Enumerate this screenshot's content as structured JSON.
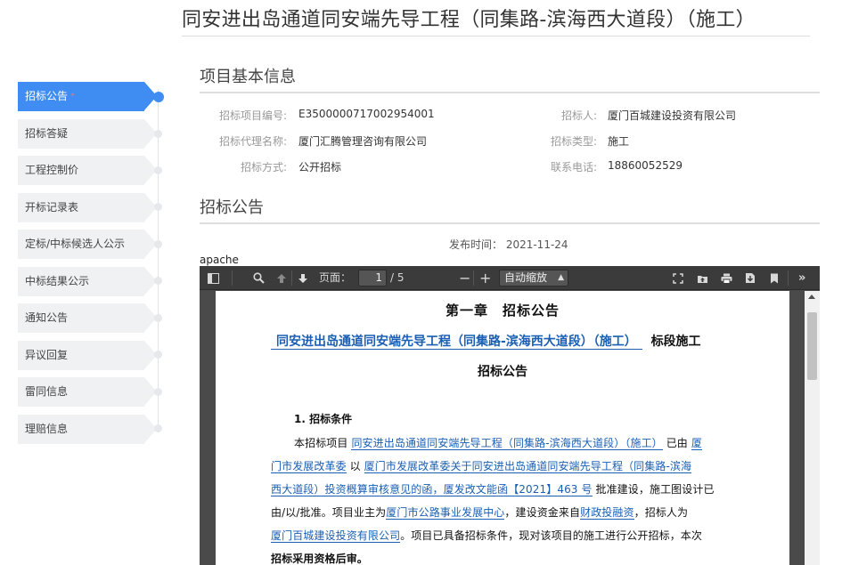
{
  "page": {
    "title": "同安进出岛通道同安端先导工程（同集路-滨海西大道段）（施工）"
  },
  "nav": {
    "items": [
      {
        "label": "招标公告",
        "active": true,
        "required": "*"
      },
      {
        "label": "招标答疑"
      },
      {
        "label": "工程控制价"
      },
      {
        "label": "开标记录表"
      },
      {
        "label": "定标/中标候选人公示"
      },
      {
        "label": "中标结果公示"
      },
      {
        "label": "通知公告"
      },
      {
        "label": "异议回复"
      },
      {
        "label": "雷同信息"
      },
      {
        "label": "理赔信息"
      }
    ]
  },
  "basic_info": {
    "section_title": "项目基本信息",
    "fields": [
      {
        "label": "招标项目编号:",
        "value": "E3500000717002954001"
      },
      {
        "label": "招标人:",
        "value": "厦门百城建设投资有限公司"
      },
      {
        "label": "招标代理名称:",
        "value": "厦门汇腾管理咨询有限公司"
      },
      {
        "label": "招标类型:",
        "value": "施工"
      },
      {
        "label": "招标方式:",
        "value": "公开招标"
      },
      {
        "label": "联系电话:",
        "value": "18860052529"
      }
    ]
  },
  "announcement": {
    "section_title": "招标公告",
    "publish_time": "发布时间： 2021-11-24"
  },
  "viewer": {
    "frame_label": "apache",
    "page_label": "页面：",
    "current_page": "1",
    "total_pages": "/ 5",
    "zoom": "自动缩放"
  },
  "document": {
    "chapter": "第一章　招标公告",
    "project_name": "同安进出岛通道同安端先导工程（同集路-滨海西大道段）（施工）",
    "project_suffix": "标段施工",
    "heading": "招标公告",
    "section1": "1. 招标条件",
    "l1_a": "本招标项目",
    "l1_b": "同安进出岛通道同安端先导工程（同集路-滨海西大道段）（施工）",
    "l1_c": "已由",
    "l1_d": "厦",
    "l2_a": "门市发展改革委",
    "l2_b": "以",
    "l2_c": "厦门市发展改革委关于同安进出岛通道同安端先导工程（同集路-滨海",
    "l3_a": "西大道段）投资概算审核意见的函，厦发改文能函【2021】463 号",
    "l3_b": "批准建设，施工图设计已",
    "l4_a": "由/以/批准。项目业主为",
    "l4_b": "厦门市公路事业发展中心",
    "l4_c": "，建设资金来自",
    "l4_d": "财政投融资",
    "l4_e": "，招标人为",
    "l5_a": "厦门百城建设投资有限公司",
    "l5_b": "。项目已具备招标条件，现对该项目的施工进行公开招标，本次",
    "l6": "招标采用资格后审。"
  },
  "colors": {
    "accent": "#3f8cf2",
    "nav_bg": "#f0f1f3",
    "link": "#1a5fb4",
    "toolbar": "#3b3b3b"
  },
  "icons": [
    "sidebar-toggle-icon",
    "search-icon",
    "prev-page-icon",
    "next-page-icon",
    "zoom-out-icon",
    "zoom-in-icon",
    "presentation-icon",
    "open-file-icon",
    "print-icon",
    "download-icon",
    "bookmark-icon",
    "tools-icon"
  ]
}
